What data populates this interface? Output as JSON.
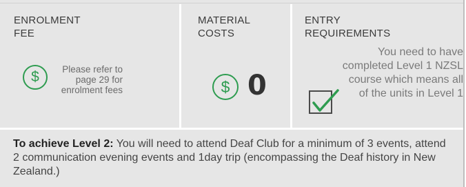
{
  "panels": {
    "enrolment": {
      "heading": "ENROLMENT\nFEE",
      "icon": "dollar-circle-icon",
      "note": "Please refer to page 29 for enrolment fees"
    },
    "material": {
      "heading": "MATERIAL\nCOSTS",
      "icon": "dollar-circle-icon",
      "value": "0"
    },
    "entry": {
      "heading": "ENTRY\nREQUIREMENTS",
      "icon": "checkbox-tick-icon",
      "text": "You need to have completed Level 1 NZSL course which means all of the units in Level 1"
    }
  },
  "achieve": {
    "lead": "To achieve Level 2:",
    "body": " You will need to attend Deaf Club for a minimum of 3 events, attend 2 communication evening events and 1day trip (encompassing the Deaf history in New Zealand.)"
  },
  "colors": {
    "background": "#e6e6e6",
    "accent_green": "#2e9c50",
    "text_dark": "#333333"
  }
}
